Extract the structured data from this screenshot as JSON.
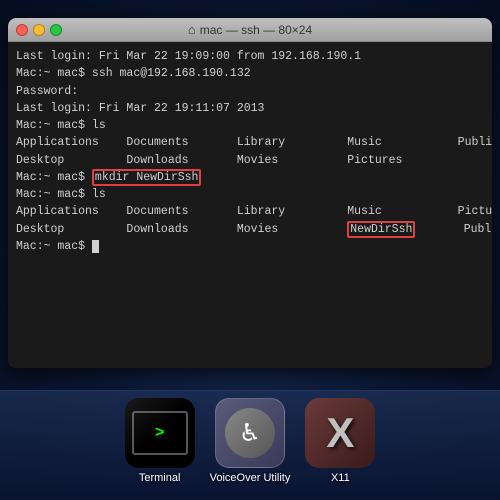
{
  "window": {
    "title": "mac — ssh — 80×24",
    "title_icon": "⌂"
  },
  "terminal": {
    "lines": [
      "Last login: Fri Mar 22 19:09:00 from 192.168.190.1",
      "Mac:~ mac$ ssh mac@192.168.190.132",
      "Password:",
      "Last login: Fri Mar 22 19:11:07 2013",
      "Mac:~ mac$ ls",
      "Applications    Documents       Library         Music           Public",
      "Desktop         Downloads       Movies          Pictures",
      "Mac:~ mac$ ",
      "Mac:~ mac$ ls",
      "Applications    Documents       Library         Music           Pictures",
      "Desktop         Downloads       Movies                          Public",
      "Mac:~ mac$ "
    ],
    "highlighted_input": "mkdir NewDirSsh",
    "highlighted_output": "NewDirSsh",
    "prompt_prefix": "Mac:~ mac$ "
  },
  "dock": {
    "items": [
      {
        "id": "terminal",
        "label": "Terminal"
      },
      {
        "id": "voiceover",
        "label": "VoiceOver Utility"
      },
      {
        "id": "x11",
        "label": "X11"
      }
    ]
  }
}
